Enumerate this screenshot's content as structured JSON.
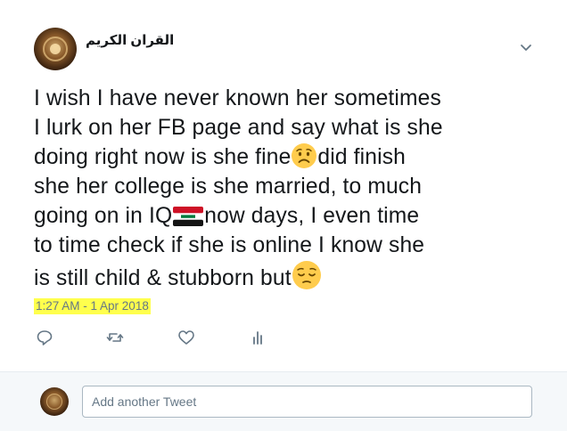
{
  "tweet": {
    "author": {
      "display_name": "القران الكريم"
    },
    "text_lines": [
      "I wish I have never known her sometimes",
      "I lurk on her FB page and say what is she",
      "doing right now is she fine",
      "did finish",
      "she her college is she married, to much",
      "going on in IQ",
      "now days, I even time",
      "to time check if she is online I know she",
      "is still child & stubborn but"
    ],
    "emojis": [
      "worried-face",
      "iraq-flag",
      "pensive-face"
    ],
    "timestamp": "1:27 AM - 1 Apr 2018",
    "timestamp_highlight": "#ffff4d",
    "actions": [
      "reply-icon",
      "retweet-icon",
      "like-icon",
      "analytics-icon"
    ]
  },
  "reply": {
    "placeholder": "Add another Tweet"
  },
  "colors": {
    "text": "#14171a",
    "muted": "#657786",
    "icon": "#657786",
    "reply_bar_bg": "#f5f8fa",
    "border": "#aab8c2"
  }
}
